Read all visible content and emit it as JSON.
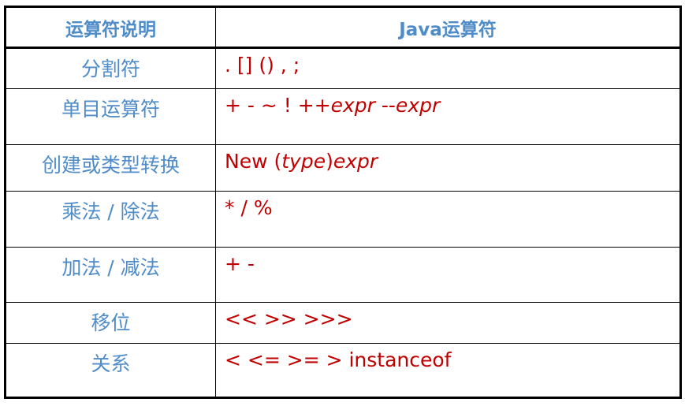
{
  "table": {
    "headers": {
      "description": "运算符说明",
      "java_operators": "Java运算符"
    },
    "rows": [
      {
        "description": "分割符",
        "operators": [
          {
            "text": ". [] () , ;",
            "italic": false
          }
        ]
      },
      {
        "description": "单目运算符",
        "operators": [
          {
            "text": "+ - ~ ! ++",
            "italic": false
          },
          {
            "text": "expr",
            "italic": true
          },
          {
            "text": " --",
            "italic": false
          },
          {
            "text": "expr",
            "italic": true
          }
        ]
      },
      {
        "description": "创建或类型转换",
        "operators": [
          {
            "text": "New (",
            "italic": false
          },
          {
            "text": "type",
            "italic": true
          },
          {
            "text": ")",
            "italic": false
          },
          {
            "text": "expr",
            "italic": true
          }
        ]
      },
      {
        "description": "乘法 / 除法",
        "operators": [
          {
            "text": "* / %",
            "italic": false
          }
        ]
      },
      {
        "description": "加法 / 减法",
        "operators": [
          {
            "text": "+ -",
            "italic": false
          }
        ]
      },
      {
        "description": "移位",
        "operators": [
          {
            "text": "<< >> >>>",
            "italic": false
          }
        ]
      },
      {
        "description": "关系",
        "operators": [
          {
            "text": "< <= >= > instanceof",
            "italic": false
          }
        ]
      }
    ],
    "colors": {
      "description_text": "#4f8cc8",
      "operator_text": "#c00000",
      "border": "#000000"
    }
  }
}
